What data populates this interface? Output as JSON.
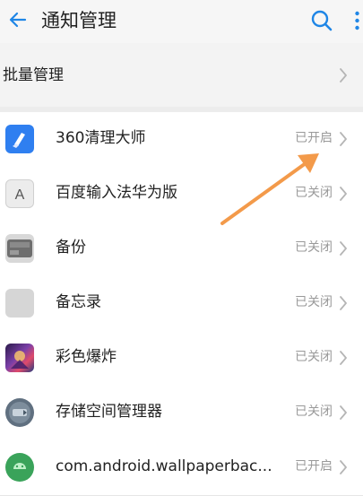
{
  "header": {
    "title": "通知管理",
    "icons": [
      "back-arrow-icon",
      "search-icon",
      "more-icon"
    ],
    "accent_color": "#1f86e6"
  },
  "batch": {
    "label": "批量管理"
  },
  "apps": [
    {
      "name": "360清理大师",
      "status": "已开启",
      "icon": "broom-icon",
      "icon_color": "#2f7ff0"
    },
    {
      "name": "百度输入法华为版",
      "status": "已关闭",
      "icon": "letter-a-icon",
      "icon_color": "#e9e9e9"
    },
    {
      "name": "备份",
      "status": "已关闭",
      "icon": "sd-card-icon",
      "icon_color": "#6e6e6e"
    },
    {
      "name": "备忘录",
      "status": "已关闭",
      "icon": "blank-app-icon",
      "icon_color": "#d6d6d6"
    },
    {
      "name": "彩色爆炸",
      "status": "已关闭",
      "icon": "game-art-icon",
      "icon_color": "#7b3fa8"
    },
    {
      "name": "存储空间管理器",
      "status": "已关闭",
      "icon": "storage-disc-icon",
      "icon_color": "#607080"
    },
    {
      "name": "com.android.wallpaperbac...",
      "status": "已开启",
      "icon": "android-icon",
      "icon_color": "#3aa35a"
    }
  ],
  "annotation": {
    "color": "#f39a4a"
  }
}
